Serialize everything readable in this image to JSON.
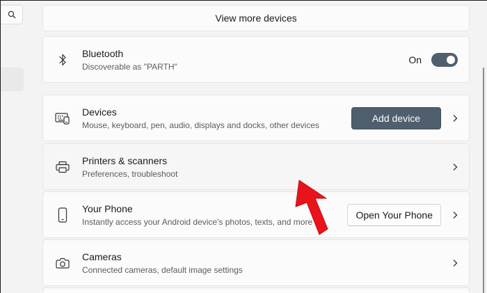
{
  "sidebar": {
    "search_icon": "search-icon"
  },
  "view_more": {
    "label": "View more devices"
  },
  "bluetooth": {
    "icon": "bluetooth-icon",
    "title": "Bluetooth",
    "subtitle": "Discoverable as \"PARTH\"",
    "toggle_label": "On",
    "toggle_state": true
  },
  "devices": {
    "icon": "keyboard-icon",
    "title": "Devices",
    "subtitle": "Mouse, keyboard, pen, audio, displays and docks, other devices",
    "button": "Add device"
  },
  "printers": {
    "icon": "printer-icon",
    "title": "Printers & scanners",
    "subtitle": "Preferences, troubleshoot"
  },
  "phone": {
    "icon": "phone-icon",
    "title": "Your Phone",
    "subtitle": "Instantly access your Android device's photos, texts, and more",
    "button": "Open Your Phone"
  },
  "cameras": {
    "icon": "camera-icon",
    "title": "Cameras",
    "subtitle": "Connected cameras, default image settings"
  },
  "colors": {
    "accent": "#4f5f6d",
    "annotation_arrow": "#e8131b"
  }
}
